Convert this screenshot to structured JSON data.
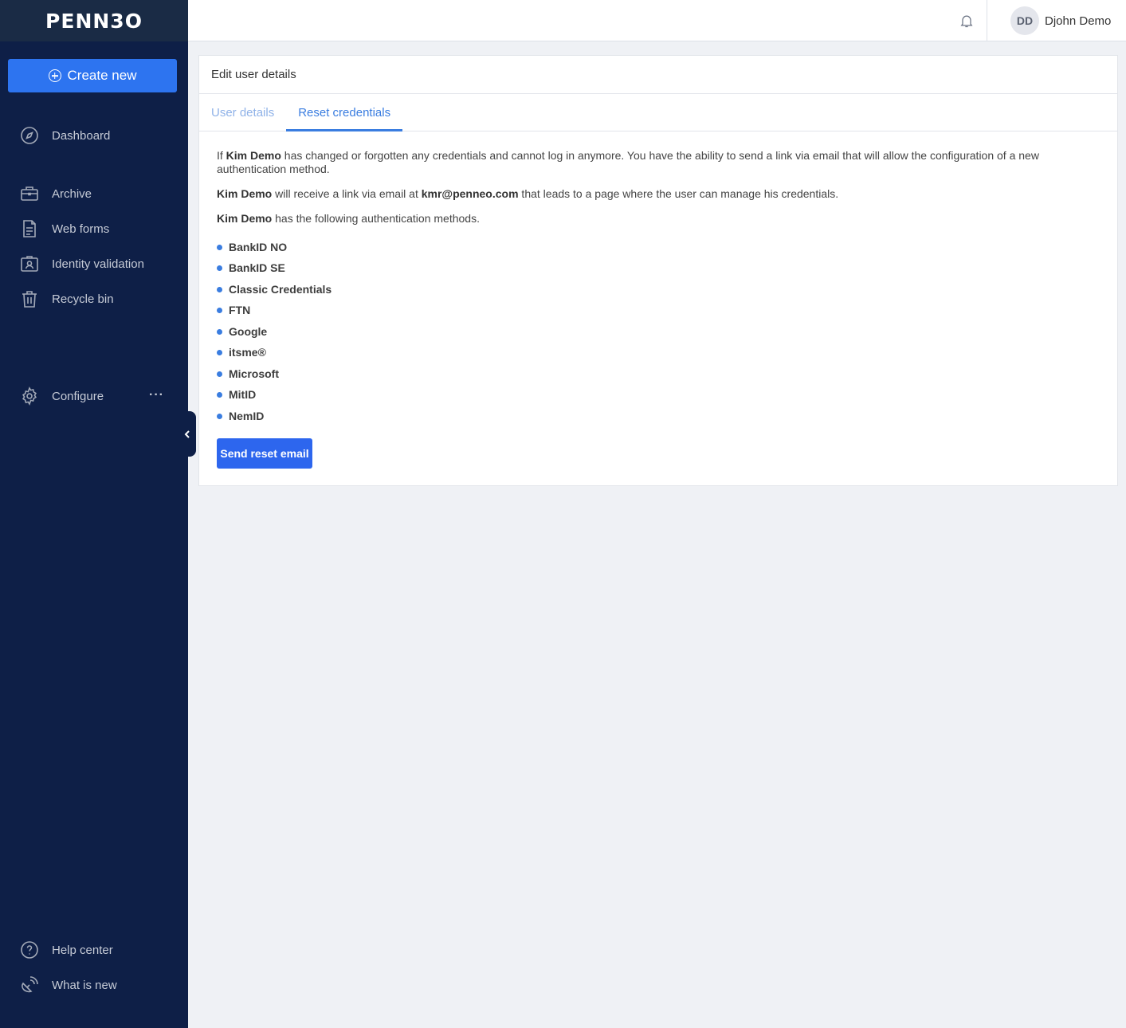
{
  "brand": {
    "logo": "PENN3O"
  },
  "sidebar": {
    "create_label": "Create new",
    "items": [
      {
        "label": "Dashboard",
        "icon": "compass-icon"
      },
      {
        "label": "Archive",
        "icon": "briefcase-icon"
      },
      {
        "label": "Web forms",
        "icon": "document-icon"
      },
      {
        "label": "Identity validation",
        "icon": "id-badge-icon"
      },
      {
        "label": "Recycle bin",
        "icon": "trash-icon"
      },
      {
        "label": "Configure",
        "icon": "gear-icon"
      },
      {
        "label": "Help center",
        "icon": "question-icon"
      },
      {
        "label": "What is new",
        "icon": "satellite-icon"
      }
    ],
    "more_label": "···"
  },
  "topbar": {
    "user_initials": "DD",
    "user_name": "Djohn Demo"
  },
  "card": {
    "title": "Edit user details",
    "tabs": [
      {
        "label": "User details"
      },
      {
        "label": "Reset credentials"
      }
    ],
    "p1": {
      "prefix": "If ",
      "name": "Kim Demo",
      "suffix": " has changed or forgotten any credentials and cannot log in anymore. You have the ability to send a link via email that will allow the configuration of a new authentication method."
    },
    "p2": {
      "name": "Kim Demo",
      "middle": " will receive a link via email at ",
      "email": "kmr@penneo.com",
      "suffix": " that leads to a page where the user can manage his credentials."
    },
    "p3": {
      "name": "Kim Demo",
      "suffix": " has the following authentication methods."
    },
    "methods": [
      "BankID NO",
      "BankID SE",
      "Classic Credentials",
      "FTN",
      "Google",
      "itsme®",
      "Microsoft",
      "MitID",
      "NemID"
    ],
    "send_label": "Send reset email"
  }
}
